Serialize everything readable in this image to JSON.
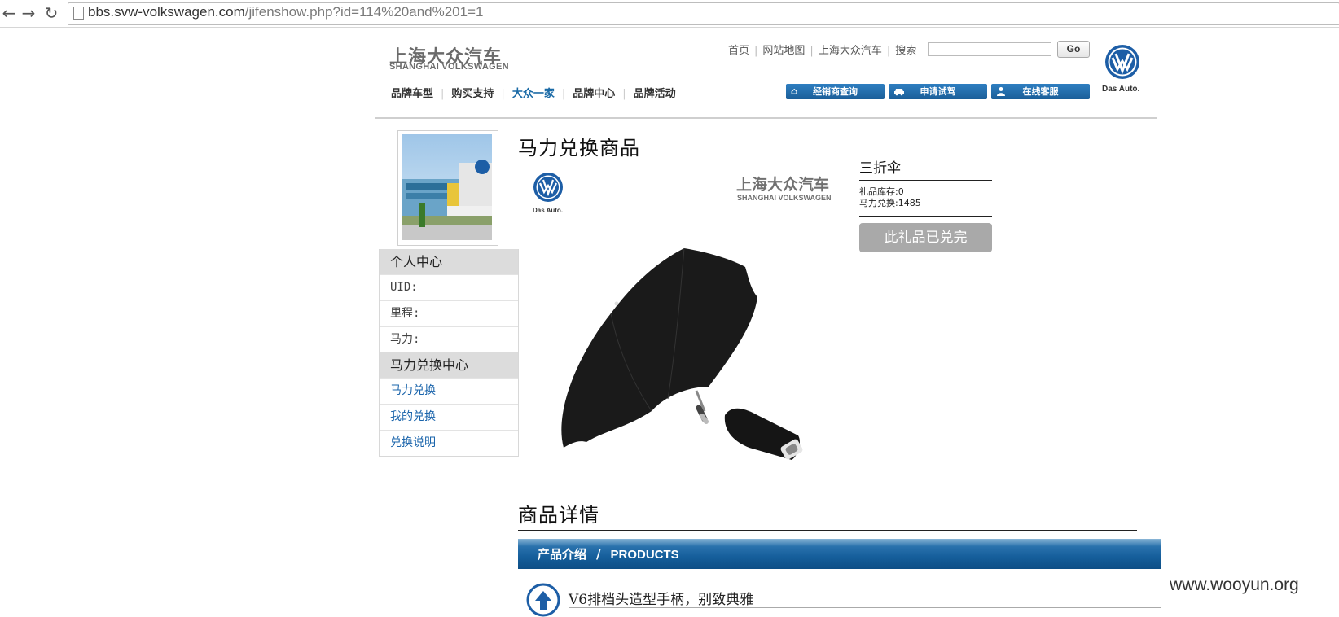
{
  "browser": {
    "url_host": "bbs.svw-volkswagen.com",
    "url_path": "/jifenshow.php?id=114%20and%201=1",
    "back_icon": "back-arrow-icon",
    "forward_icon": "forward-arrow-icon",
    "reload_icon": "reload-icon"
  },
  "header": {
    "logo_cn": "上海大众汽车",
    "logo_en": "SHANGHAI VOLKSWAGEN",
    "top_links": [
      "首页",
      "网站地图",
      "上海大众汽车",
      "搜索"
    ],
    "search_button": "Go",
    "brand_tagline": "Das Auto.",
    "main_nav": [
      {
        "label": "品牌车型"
      },
      {
        "label": "购买支持"
      },
      {
        "label": "大众一家"
      },
      {
        "label": "品牌中心"
      },
      {
        "label": "品牌活动"
      }
    ],
    "action_buttons": [
      {
        "label": "经销商查询",
        "icon": "home-icon"
      },
      {
        "label": "申请试驾",
        "icon": "car-icon"
      },
      {
        "label": "在线客服",
        "icon": "person-icon"
      }
    ]
  },
  "sidebar": {
    "personal_center_title": "个人中心",
    "fields": [
      "UID:",
      "里程:",
      "马力:"
    ],
    "exchange_center_title": "马力兑换中心",
    "links": [
      "马力兑换",
      "我的兑换",
      "兑换说明"
    ]
  },
  "product": {
    "page_title": "马力兑换商品",
    "image_logo_cn": "上海大众汽车",
    "image_logo_en": "SHANGHAI VOLKSWAGEN",
    "image_tagline": "Das Auto.",
    "gift_name": "三折伞",
    "stock_label": "礼品库存:0",
    "price_label": "马力兑换:1485",
    "sold_out_button": "此礼品已兑完"
  },
  "details": {
    "title": "商品详情",
    "bar_cn": "产品介绍",
    "bar_sep": "/",
    "bar_en": "PRODUCTS",
    "feature_text": "V6排档头造型手柄，别致典雅"
  },
  "watermark": "www.wooyun.org",
  "colors": {
    "link_blue": "#1a64ab",
    "button_blue": "#1a5e98",
    "sold_out_gray": "#a9a9a9"
  }
}
